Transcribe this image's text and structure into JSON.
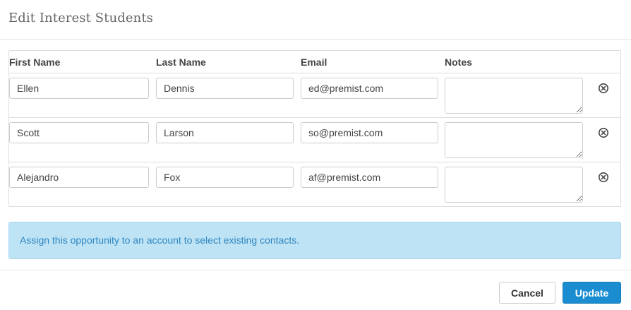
{
  "modal": {
    "title": "Edit Interest Students"
  },
  "table": {
    "headers": {
      "first_name": "First Name",
      "last_name": "Last Name",
      "email": "Email",
      "notes": "Notes"
    },
    "rows": [
      {
        "first_name": "Ellen",
        "last_name": "Dennis",
        "email": "ed@premist.com",
        "notes": ""
      },
      {
        "first_name": "Scott",
        "last_name": "Larson",
        "email": "so@premist.com",
        "notes": ""
      },
      {
        "first_name": "Alejandro",
        "last_name": "Fox",
        "email": "af@premist.com",
        "notes": ""
      }
    ],
    "remove_icon": "close-circle-icon"
  },
  "alert": {
    "message": "Assign this opportunity to an account to select existing contacts."
  },
  "footer": {
    "cancel_label": "Cancel",
    "update_label": "Update"
  },
  "colors": {
    "primary": "#1a8dd1",
    "alert_bg": "#bde3f5",
    "alert_text": "#2f86c0"
  }
}
